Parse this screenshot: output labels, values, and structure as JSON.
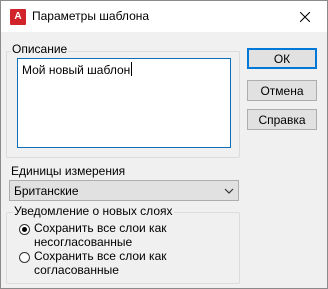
{
  "window": {
    "title": "Параметры шаблона",
    "app_icon_text": "A"
  },
  "description": {
    "legend": "Описание",
    "value": "Мой новый шаблон"
  },
  "buttons": {
    "ok": "ОК",
    "cancel": "Отмена",
    "help": "Справка"
  },
  "units": {
    "label": "Единицы измерения",
    "selected": "Британские"
  },
  "layer_notification": {
    "legend": "Уведомление о новых слоях",
    "options": [
      {
        "label": "Сохранить все слои как несогласованные",
        "checked": true
      },
      {
        "label": "Сохранить все слои как согласованные",
        "checked": false
      }
    ]
  },
  "colors": {
    "accent": "#0078d7",
    "app_icon": "#d1242a"
  }
}
